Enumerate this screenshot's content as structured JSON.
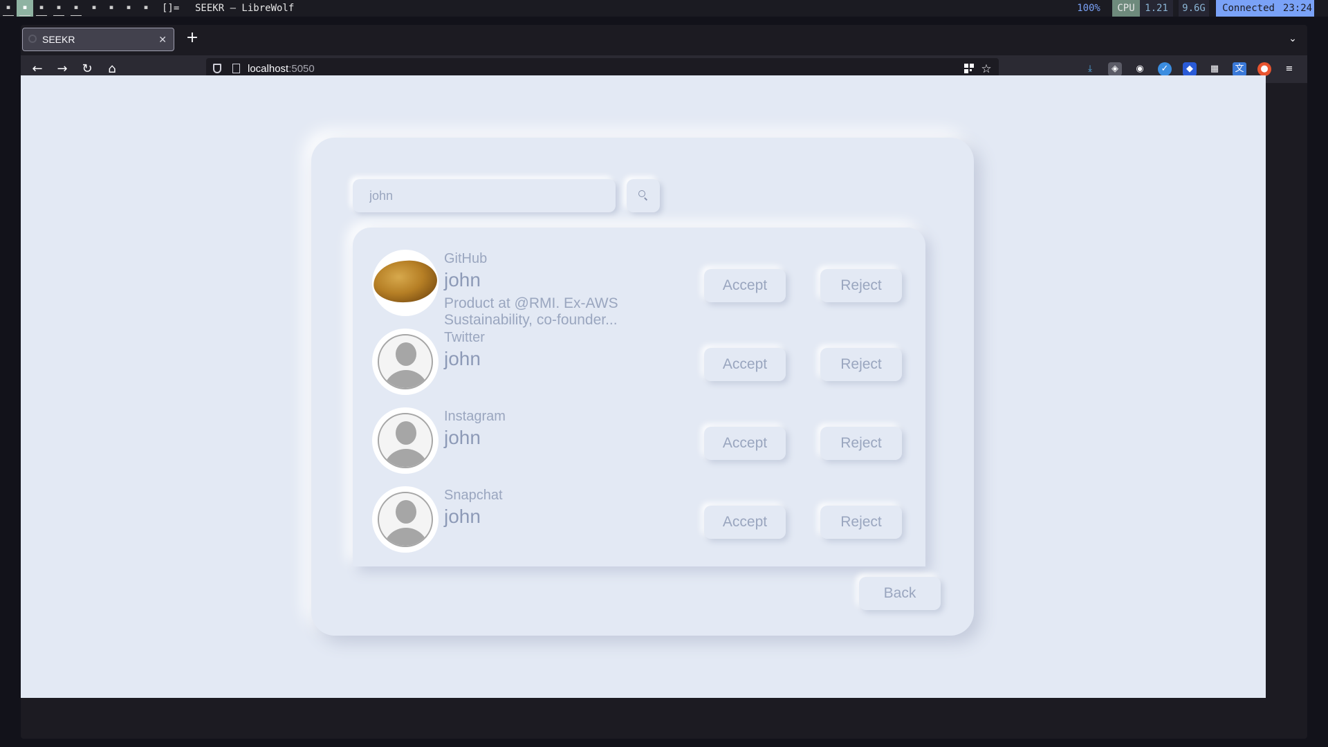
{
  "system_bar": {
    "layout_symbol": "[]=",
    "window_title": "SEEKR — LibreWolf",
    "zoom": "100%",
    "cpu_label": "CPU",
    "cpu_load": "1.21",
    "memory": "9.6G",
    "network": "Connected",
    "clock": "23:24"
  },
  "browser": {
    "tab_title": "SEEKR",
    "url_host": "localhost",
    "url_port": ":5050"
  },
  "search": {
    "value": "john",
    "icon": "search-icon"
  },
  "results": [
    {
      "platform": "GitHub",
      "username": "john",
      "description": "Product at @RMI. Ex-AWS Sustainability, co-founder...",
      "avatar": "potato-photo",
      "accept_label": "Accept",
      "reject_label": "Reject"
    },
    {
      "platform": "Twitter",
      "username": "john",
      "description": "",
      "avatar": "default-user-icon",
      "accept_label": "Accept",
      "reject_label": "Reject"
    },
    {
      "platform": "Instagram",
      "username": "john",
      "description": "",
      "avatar": "default-user-icon",
      "accept_label": "Accept",
      "reject_label": "Reject"
    },
    {
      "platform": "Snapchat",
      "username": "john",
      "description": "",
      "avatar": "default-user-icon",
      "accept_label": "Accept",
      "reject_label": "Reject"
    }
  ],
  "back_label": "Back",
  "colors": {
    "page_background": "#e3e9f4",
    "text_muted": "#9aa6bf",
    "status_connected": "#7aa2f7",
    "active_workspace": "#8fb3a2"
  }
}
